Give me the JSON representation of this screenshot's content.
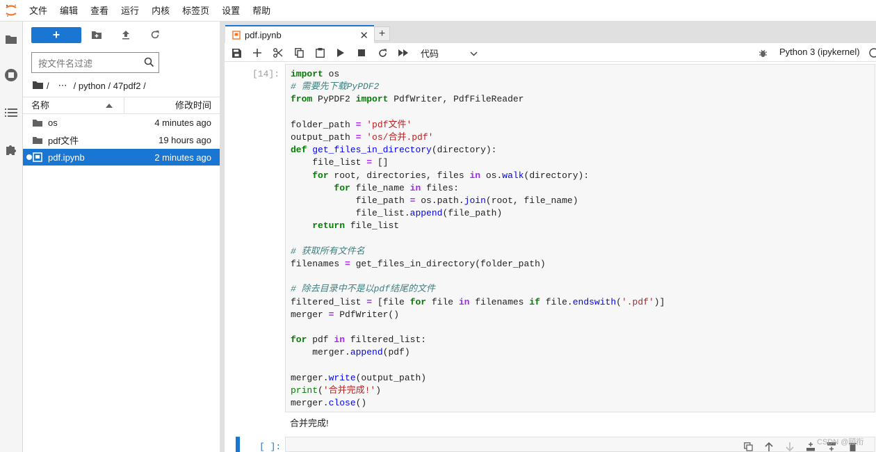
{
  "menu": [
    "文件",
    "编辑",
    "查看",
    "运行",
    "内核",
    "标签页",
    "设置",
    "帮助"
  ],
  "filebrowser": {
    "new_label": "+",
    "filter_placeholder": "按文件名过滤",
    "breadcrumbs": [
      "/",
      "⋯",
      "/ python / 47pdf2 /"
    ],
    "columns": {
      "name": "名称",
      "modified": "修改时间"
    },
    "files": [
      {
        "name": "os",
        "modified": "4 minutes ago",
        "type": "folder"
      },
      {
        "name": "pdf文件",
        "modified": "19 hours ago",
        "type": "folder"
      },
      {
        "name": "pdf.ipynb",
        "modified": "2 minutes ago",
        "type": "notebook",
        "selected": true,
        "running": true
      }
    ]
  },
  "tab": {
    "title": "pdf.ipynb",
    "close": "✕",
    "add": "+"
  },
  "toolbar": {
    "cell_type": "代码",
    "kernel": "Python 3 (ipykernel)"
  },
  "cell1": {
    "prompt": "[14]:",
    "output": "合并完成!",
    "code": [
      "import os",
      "# 需要先下载PyPDF2",
      "from PyPDF2 import PdfWriter, PdfFileReader",
      "",
      "folder_path = 'pdf文件'",
      "output_path = 'os/合并.pdf'",
      "def get_files_in_directory(directory):",
      "    file_list = []",
      "    for root, directories, files in os.walk(directory):",
      "        for file_name in files:",
      "            file_path = os.path.join(root, file_name)",
      "            file_list.append(file_path)",
      "    return file_list",
      "",
      "# 获取所有文件名",
      "filenames = get_files_in_directory(folder_path)",
      "",
      "# 除去目录中不是以pdf结尾的文件",
      "filtered_list = [file for file in filenames if file.endswith('.pdf')]",
      "merger = PdfWriter()",
      "",
      "for pdf in filtered_list:",
      "    merger.append(pdf)",
      "",
      "merger.write(output_path)",
      "print('合并完成!')",
      "merger.close()"
    ]
  },
  "cell2": {
    "prompt": "[ ]:"
  },
  "watermark": "CSDN @顾衔",
  "colors": {
    "accent": "#1976d2",
    "keyword": "#008000",
    "comment": "#408080",
    "string": "#ba2121"
  }
}
